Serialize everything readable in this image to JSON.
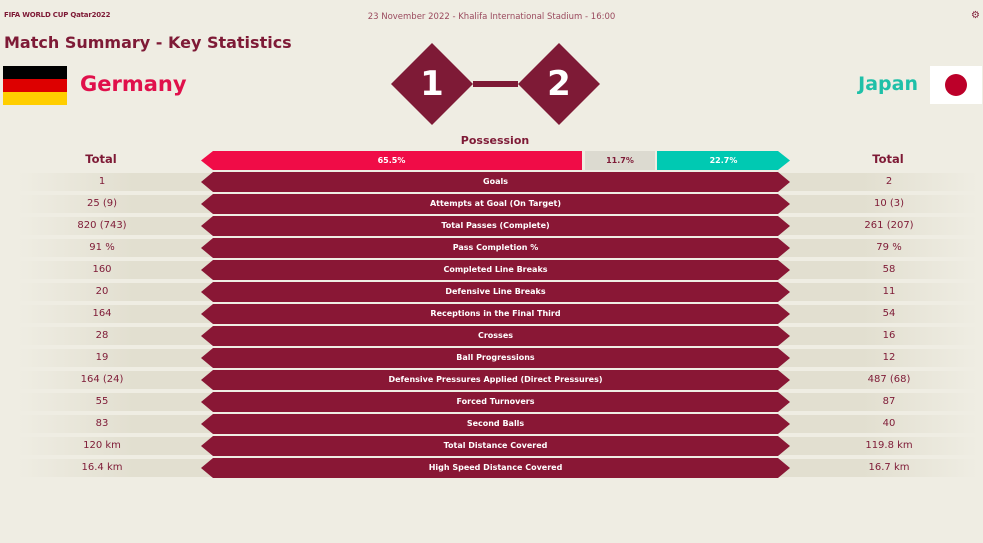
{
  "header": {
    "logo_text": "FIFA WORLD CUP Qatar2022",
    "match_info": "23 November 2022 - Khalifa International Stadium - 16:00",
    "corner_icon": "gear-icon"
  },
  "page_title": "Match Summary - Key Statistics",
  "home_team": {
    "name": "Germany",
    "score": "1",
    "flag_colors": [
      "#000000",
      "#dd0000",
      "#ffce00"
    ],
    "accent": "#e0104b"
  },
  "away_team": {
    "name": "Japan",
    "score": "2",
    "flag_colors": [
      "#ffffff",
      "#bc0029"
    ],
    "accent": "#1ec0a8"
  },
  "possession": {
    "title": "Possession",
    "home": "65.5%",
    "neutral": "11.7%",
    "away": "22.7%",
    "home_color": "#f00c47",
    "neutral_color": "#dcdad0",
    "away_color": "#00c9b2"
  },
  "total_label_home": "Total",
  "total_label_away": "Total",
  "stats": [
    {
      "label": "Goals",
      "home": "1",
      "away": "2"
    },
    {
      "label": "Attempts at Goal (On Target)",
      "home": "25 (9)",
      "away": "10 (3)"
    },
    {
      "label": "Total Passes (Complete)",
      "home": "820 (743)",
      "away": "261 (207)"
    },
    {
      "label": "Pass Completion %",
      "home": "91 %",
      "away": "79 %"
    },
    {
      "label": "Completed Line Breaks",
      "home": "160",
      "away": "58"
    },
    {
      "label": "Defensive Line Breaks",
      "home": "20",
      "away": "11"
    },
    {
      "label": "Receptions in the Final Third",
      "home": "164",
      "away": "54"
    },
    {
      "label": "Crosses",
      "home": "28",
      "away": "16"
    },
    {
      "label": "Ball Progressions",
      "home": "19",
      "away": "12"
    },
    {
      "label": "Defensive Pressures Applied (Direct Pressures)",
      "home": "164 (24)",
      "away": "487 (68)"
    },
    {
      "label": "Forced Turnovers",
      "home": "55",
      "away": "87"
    },
    {
      "label": "Second Balls",
      "home": "83",
      "away": "40"
    },
    {
      "label": "Total Distance Covered",
      "home": "120 km",
      "away": "119.8 km"
    },
    {
      "label": "High Speed Distance Covered",
      "home": "16.4 km",
      "away": "16.7 km"
    }
  ]
}
